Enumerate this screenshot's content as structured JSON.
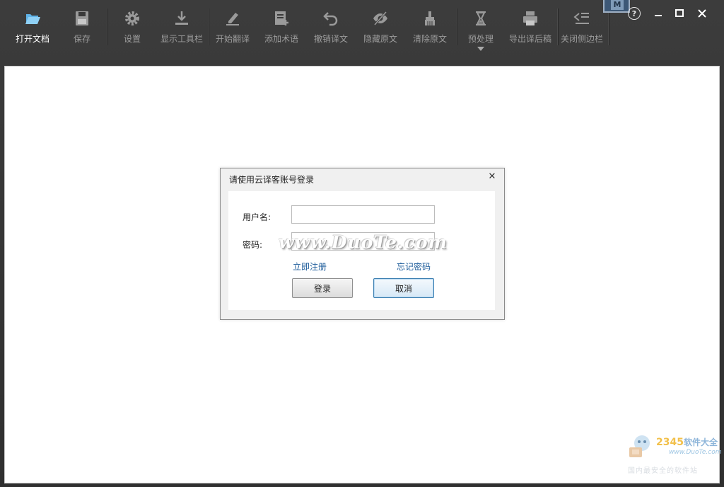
{
  "toolbar": {
    "items": [
      {
        "label": "打开文档",
        "icon": "folder-open-icon",
        "active": true
      },
      {
        "label": "保存",
        "icon": "save-icon"
      },
      {
        "label": "设置",
        "icon": "gear-icon"
      },
      {
        "label": "显示工具栏",
        "icon": "download-icon"
      },
      {
        "label": "开始翻译",
        "icon": "pencil-icon"
      },
      {
        "label": "添加术语",
        "icon": "add-note-icon"
      },
      {
        "label": "撤销译文",
        "icon": "undo-icon"
      },
      {
        "label": "隐藏原文",
        "icon": "eye-hidden-icon"
      },
      {
        "label": "清除原文",
        "icon": "brush-icon"
      },
      {
        "label": "预处理",
        "icon": "hourglass-icon"
      },
      {
        "label": "导出译后稿",
        "icon": "printer-icon"
      },
      {
        "label": "关闭侧边栏",
        "icon": "collapse-sidebar-icon"
      }
    ]
  },
  "window": {
    "help": "?",
    "minimize": "—",
    "maximize": "□",
    "close": "✕",
    "logo_letter": "M"
  },
  "dialog": {
    "title": "请使用云译客账号登录",
    "close": "✕",
    "username_label": "用户名:",
    "username_value": "",
    "password_label": "密码:",
    "password_value": "",
    "register_link": "立即注册",
    "forgot_link": "忘记密码",
    "login_button": "登录",
    "cancel_button": "取消"
  },
  "watermarks": {
    "center": "www.DuoTe.com",
    "corner_brand": "2345",
    "corner_brand_rest": "软件大全",
    "corner_site": "www.DuoTe.com",
    "corner_slogan": "国内最安全的软件站"
  },
  "colors": {
    "toolbar_bg": "#333333",
    "link": "#1a5a99",
    "primary_border": "#3c7fb1"
  }
}
